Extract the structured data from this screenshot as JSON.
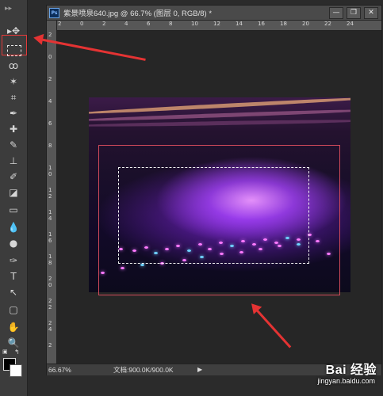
{
  "document": {
    "title": "紫景喷泉640.jpg @ 66.7% (图层 0, RGB/8) *",
    "ps_badge": "Ps",
    "window_buttons": [
      "—",
      "❐",
      "✕"
    ],
    "zoom": "66.67%",
    "doc_info": "文档:900.0K/900.0K",
    "play_icon": "▶"
  },
  "rulers": {
    "top": [
      "2",
      "0",
      "2",
      "4",
      "6",
      "8",
      "10",
      "12",
      "14",
      "16",
      "18",
      "20",
      "22",
      "24"
    ],
    "left": [
      "2",
      "0",
      "2",
      "4",
      "6",
      "8",
      "1 0",
      "1 2",
      "1 4",
      "1 6",
      "1 8",
      "2 0",
      "2 2",
      "2 4",
      "2"
    ]
  },
  "tools": [
    {
      "icon": "move-tool-icon",
      "glyph": "▸✥"
    },
    {
      "icon": "rect-marquee-tool-icon",
      "glyph": ""
    },
    {
      "icon": "lasso-tool-icon",
      "glyph": "ꝏ"
    },
    {
      "icon": "magic-wand-tool-icon",
      "glyph": "✶"
    },
    {
      "icon": "crop-tool-icon",
      "glyph": "⌗"
    },
    {
      "icon": "eyedropper-tool-icon",
      "glyph": "✒"
    },
    {
      "icon": "healing-brush-tool-icon",
      "glyph": "✚"
    },
    {
      "icon": "brush-tool-icon",
      "glyph": "✎"
    },
    {
      "icon": "clone-stamp-tool-icon",
      "glyph": "⊥"
    },
    {
      "icon": "history-brush-tool-icon",
      "glyph": "✐"
    },
    {
      "icon": "eraser-tool-icon",
      "glyph": "◪"
    },
    {
      "icon": "gradient-tool-icon",
      "glyph": "▭"
    },
    {
      "icon": "blur-tool-icon",
      "glyph": "💧"
    },
    {
      "icon": "dodge-tool-icon",
      "glyph": "●"
    },
    {
      "icon": "pen-tool-icon",
      "glyph": "✑"
    },
    {
      "icon": "type-tool-icon",
      "glyph": "T"
    },
    {
      "icon": "path-selection-tool-icon",
      "glyph": "↖"
    },
    {
      "icon": "shape-tool-icon",
      "glyph": "▢"
    },
    {
      "icon": "hand-tool-icon",
      "glyph": "✋"
    },
    {
      "icon": "zoom-tool-icon",
      "glyph": "🔍"
    }
  ],
  "watermark": {
    "brand": "Bai 经验",
    "url": "jingyan.baidu.com"
  },
  "colors": {
    "foreground": "#000000",
    "background": "#ffffff",
    "annotation_red": "#e43333"
  }
}
